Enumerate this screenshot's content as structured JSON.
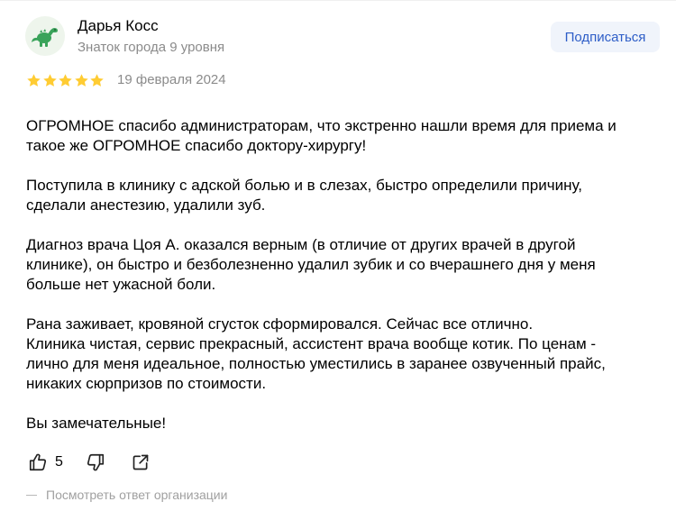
{
  "author": {
    "name": "Дарья Косс",
    "level": "Знаток города 9 уровня",
    "avatar_icon": "dinosaur-icon",
    "subscribe_label": "Подписаться"
  },
  "rating": {
    "stars": 5,
    "max": 5,
    "color": "#fc3"
  },
  "date": "19 февраля 2024",
  "review": {
    "paragraphs": [
      "ОГРОМНОЕ спасибо администраторам, что экстренно нашли время для приема и\nтакое же ОГРОМНОЕ спасибо доктору-хирургу!",
      "Поступила в клинику с адской болью и в слезах, быстро определили причину,\nсделали анестезию, удалили зуб.",
      "Диагноз врача Цоя А. оказался верным (в отличие от других врачей в другой\nклинике), он быстро и безболезненно удалил зубик и со вчерашнего дня у меня\nбольше нет ужасной боли.",
      "Рана заживает, кровяной сгусток сформировался. Сейчас все отлично.\nКлиника чистая, сервис прекрасный, ассистент врача вообще котик. По ценам -\nлично для меня идеальное, полностью уместились в заранее озвученный прайс,\nникаких сюрпризов по стоимости.",
      "Вы замечательные!"
    ]
  },
  "actions": {
    "like_icon": "thumbs-up-icon",
    "like_count": "5",
    "dislike_icon": "thumbs-down-icon",
    "share_icon": "share-icon"
  },
  "org_reply_label": "Посмотреть ответ организации",
  "colors": {
    "accent": "#2d5dc7",
    "subscribe_bg": "#f0f4fb",
    "muted": "#8b8b8b",
    "star": "#fc3"
  }
}
